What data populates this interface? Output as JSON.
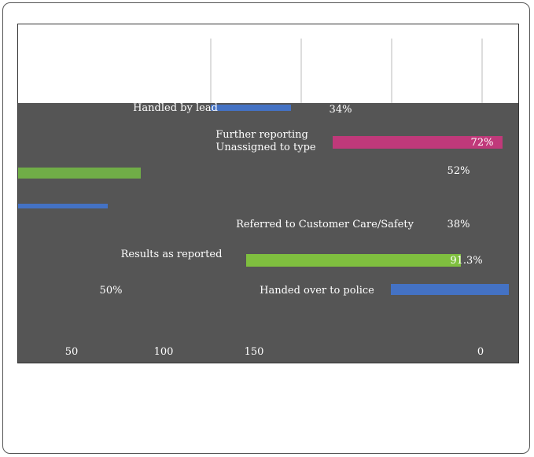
{
  "chart_data": {
    "type": "bar",
    "orientation": "horizontal",
    "categories": [
      "Handled by lead",
      "Further reporting",
      "Unassigned to type",
      "Referred to Customer Care/Safety",
      "Results as reported",
      "Handed over to police"
    ],
    "series": [
      {
        "values": [
          34,
          72,
          52,
          38,
          91,
          50
        ],
        "colors": [
          "#4472c4",
          "#c0397a",
          "#70ad47",
          "#4472c4",
          "#7fbf3f",
          "#4472c4"
        ]
      }
    ],
    "value_labels": [
      "34%",
      "72%",
      "52%",
      "38%",
      "91.3%",
      "50%"
    ],
    "x_ticks": [
      "50",
      "100",
      "150",
      "0"
    ],
    "grid": true,
    "background": "#555555",
    "label_color": "#ffffff"
  }
}
